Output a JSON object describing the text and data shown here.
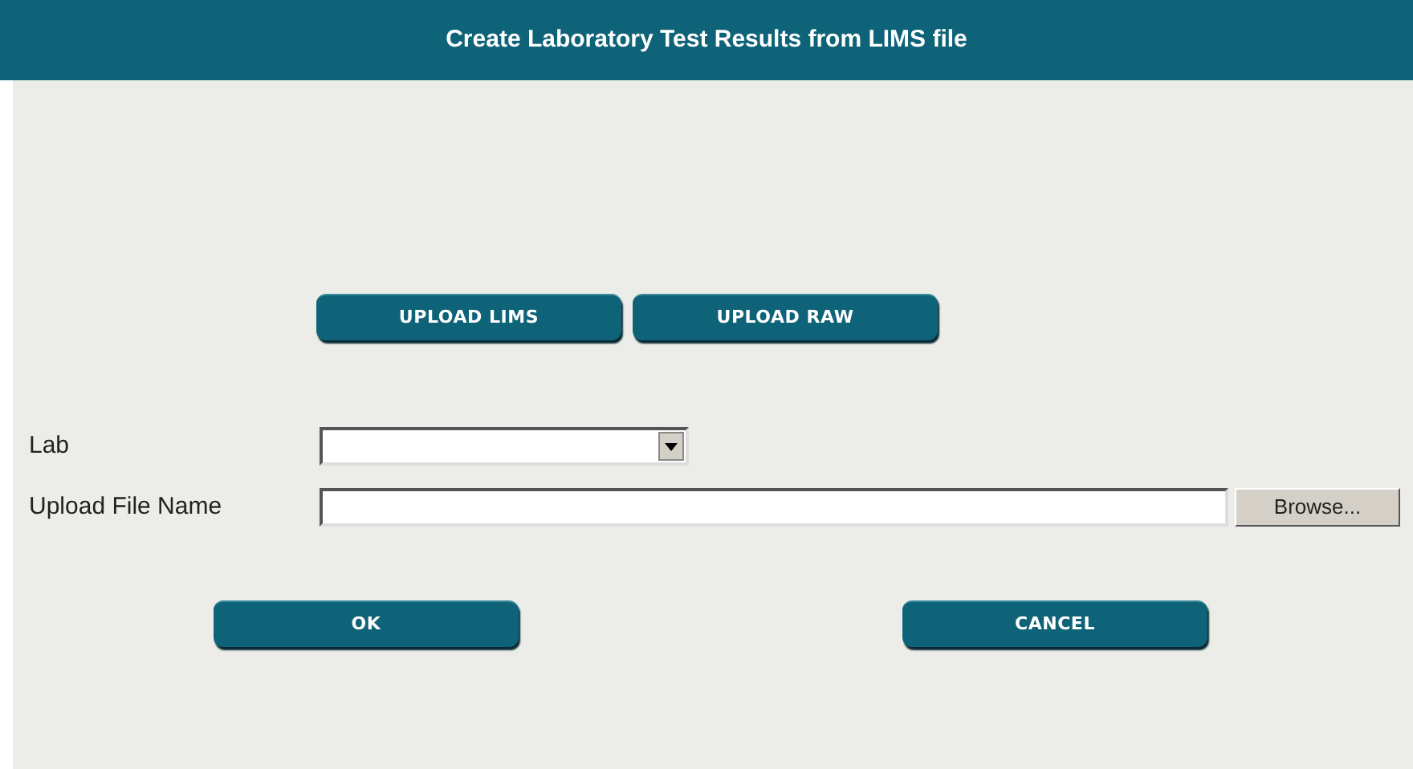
{
  "header": {
    "title": "Create Laboratory Test Results from LIMS file"
  },
  "upload_buttons": [
    "UPLOAD LIMS",
    "UPLOAD RAW"
  ],
  "fields": [
    {
      "kind": "select",
      "label": "Lab"
    },
    {
      "kind": "file",
      "label": "Upload File Name",
      "button": "Browse..."
    }
  ],
  "actions": [
    "OK",
    "CANCEL"
  ]
}
